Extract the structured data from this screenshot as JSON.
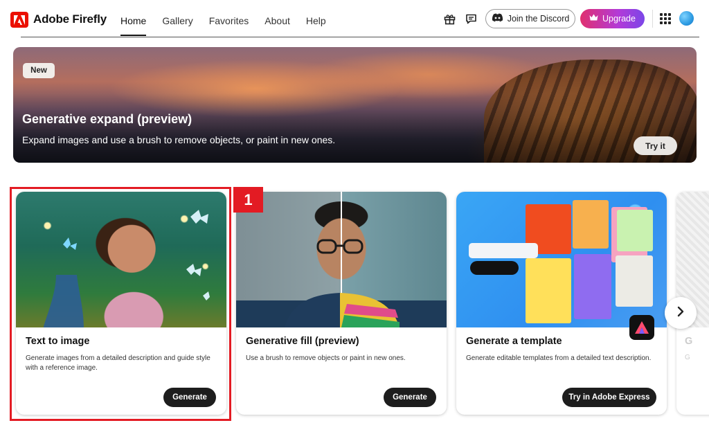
{
  "header": {
    "app_title": "Adobe Firefly",
    "nav": [
      {
        "label": "Home",
        "active": true
      },
      {
        "label": "Gallery",
        "active": false
      },
      {
        "label": "Favorites",
        "active": false
      },
      {
        "label": "About",
        "active": false
      },
      {
        "label": "Help",
        "active": false
      }
    ],
    "discord_label": "Join the Discord",
    "upgrade_label": "Upgrade",
    "icons": [
      "gift-icon",
      "feedback-icon",
      "discord-icon",
      "crown-icon",
      "apps-grid-icon",
      "avatar"
    ]
  },
  "banner": {
    "badge": "New",
    "title": "Generative expand (preview)",
    "subtitle": "Expand images and use a brush to remove objects, or paint in new ones.",
    "button": "Try it"
  },
  "cards": [
    {
      "title": "Text to image",
      "description": "Generate images from a detailed description and guide style with a reference image.",
      "button": "Generate"
    },
    {
      "title": "Generative fill (preview)",
      "description": "Use a brush to remove objects or paint in new ones.",
      "button": "Generate"
    },
    {
      "title": "Generate a template",
      "description": "Generate editable templates from a detailed text description.",
      "button": "Try in Adobe Express"
    }
  ],
  "peek_card": {
    "title": "G",
    "description": "G"
  },
  "annotation": {
    "step": "1"
  },
  "colors": {
    "brand_red": "#eb1000",
    "highlight_red": "#e31b23",
    "upgrade_start": "#e0306f",
    "upgrade_end": "#7b47e8",
    "button_dark": "#1d1d1d"
  }
}
